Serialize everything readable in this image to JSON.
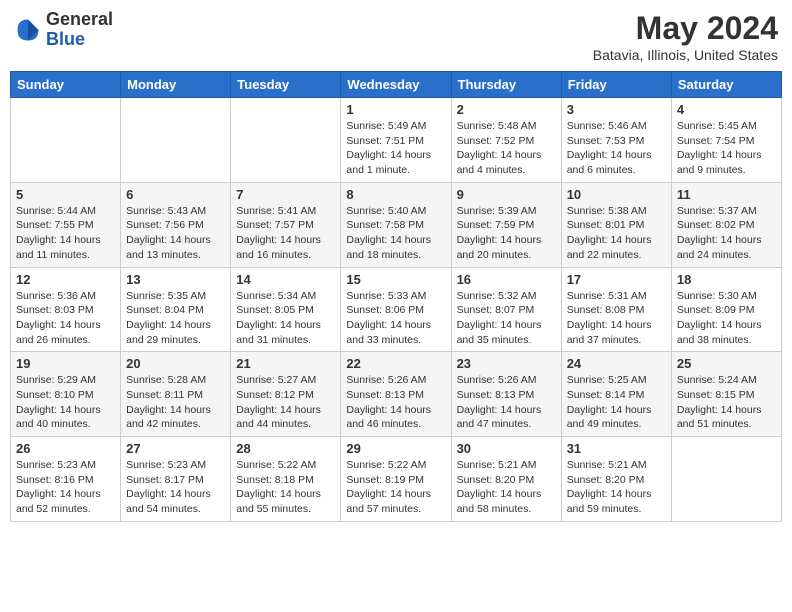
{
  "header": {
    "logo_general": "General",
    "logo_blue": "Blue",
    "month": "May 2024",
    "location": "Batavia, Illinois, United States"
  },
  "days_of_week": [
    "Sunday",
    "Monday",
    "Tuesday",
    "Wednesday",
    "Thursday",
    "Friday",
    "Saturday"
  ],
  "weeks": [
    [
      {
        "day": "",
        "sunrise": "",
        "sunset": "",
        "daylight": ""
      },
      {
        "day": "",
        "sunrise": "",
        "sunset": "",
        "daylight": ""
      },
      {
        "day": "",
        "sunrise": "",
        "sunset": "",
        "daylight": ""
      },
      {
        "day": "1",
        "sunrise": "Sunrise: 5:49 AM",
        "sunset": "Sunset: 7:51 PM",
        "daylight": "Daylight: 14 hours and 1 minute."
      },
      {
        "day": "2",
        "sunrise": "Sunrise: 5:48 AM",
        "sunset": "Sunset: 7:52 PM",
        "daylight": "Daylight: 14 hours and 4 minutes."
      },
      {
        "day": "3",
        "sunrise": "Sunrise: 5:46 AM",
        "sunset": "Sunset: 7:53 PM",
        "daylight": "Daylight: 14 hours and 6 minutes."
      },
      {
        "day": "4",
        "sunrise": "Sunrise: 5:45 AM",
        "sunset": "Sunset: 7:54 PM",
        "daylight": "Daylight: 14 hours and 9 minutes."
      }
    ],
    [
      {
        "day": "5",
        "sunrise": "Sunrise: 5:44 AM",
        "sunset": "Sunset: 7:55 PM",
        "daylight": "Daylight: 14 hours and 11 minutes."
      },
      {
        "day": "6",
        "sunrise": "Sunrise: 5:43 AM",
        "sunset": "Sunset: 7:56 PM",
        "daylight": "Daylight: 14 hours and 13 minutes."
      },
      {
        "day": "7",
        "sunrise": "Sunrise: 5:41 AM",
        "sunset": "Sunset: 7:57 PM",
        "daylight": "Daylight: 14 hours and 16 minutes."
      },
      {
        "day": "8",
        "sunrise": "Sunrise: 5:40 AM",
        "sunset": "Sunset: 7:58 PM",
        "daylight": "Daylight: 14 hours and 18 minutes."
      },
      {
        "day": "9",
        "sunrise": "Sunrise: 5:39 AM",
        "sunset": "Sunset: 7:59 PM",
        "daylight": "Daylight: 14 hours and 20 minutes."
      },
      {
        "day": "10",
        "sunrise": "Sunrise: 5:38 AM",
        "sunset": "Sunset: 8:01 PM",
        "daylight": "Daylight: 14 hours and 22 minutes."
      },
      {
        "day": "11",
        "sunrise": "Sunrise: 5:37 AM",
        "sunset": "Sunset: 8:02 PM",
        "daylight": "Daylight: 14 hours and 24 minutes."
      }
    ],
    [
      {
        "day": "12",
        "sunrise": "Sunrise: 5:36 AM",
        "sunset": "Sunset: 8:03 PM",
        "daylight": "Daylight: 14 hours and 26 minutes."
      },
      {
        "day": "13",
        "sunrise": "Sunrise: 5:35 AM",
        "sunset": "Sunset: 8:04 PM",
        "daylight": "Daylight: 14 hours and 29 minutes."
      },
      {
        "day": "14",
        "sunrise": "Sunrise: 5:34 AM",
        "sunset": "Sunset: 8:05 PM",
        "daylight": "Daylight: 14 hours and 31 minutes."
      },
      {
        "day": "15",
        "sunrise": "Sunrise: 5:33 AM",
        "sunset": "Sunset: 8:06 PM",
        "daylight": "Daylight: 14 hours and 33 minutes."
      },
      {
        "day": "16",
        "sunrise": "Sunrise: 5:32 AM",
        "sunset": "Sunset: 8:07 PM",
        "daylight": "Daylight: 14 hours and 35 minutes."
      },
      {
        "day": "17",
        "sunrise": "Sunrise: 5:31 AM",
        "sunset": "Sunset: 8:08 PM",
        "daylight": "Daylight: 14 hours and 37 minutes."
      },
      {
        "day": "18",
        "sunrise": "Sunrise: 5:30 AM",
        "sunset": "Sunset: 8:09 PM",
        "daylight": "Daylight: 14 hours and 38 minutes."
      }
    ],
    [
      {
        "day": "19",
        "sunrise": "Sunrise: 5:29 AM",
        "sunset": "Sunset: 8:10 PM",
        "daylight": "Daylight: 14 hours and 40 minutes."
      },
      {
        "day": "20",
        "sunrise": "Sunrise: 5:28 AM",
        "sunset": "Sunset: 8:11 PM",
        "daylight": "Daylight: 14 hours and 42 minutes."
      },
      {
        "day": "21",
        "sunrise": "Sunrise: 5:27 AM",
        "sunset": "Sunset: 8:12 PM",
        "daylight": "Daylight: 14 hours and 44 minutes."
      },
      {
        "day": "22",
        "sunrise": "Sunrise: 5:26 AM",
        "sunset": "Sunset: 8:13 PM",
        "daylight": "Daylight: 14 hours and 46 minutes."
      },
      {
        "day": "23",
        "sunrise": "Sunrise: 5:26 AM",
        "sunset": "Sunset: 8:13 PM",
        "daylight": "Daylight: 14 hours and 47 minutes."
      },
      {
        "day": "24",
        "sunrise": "Sunrise: 5:25 AM",
        "sunset": "Sunset: 8:14 PM",
        "daylight": "Daylight: 14 hours and 49 minutes."
      },
      {
        "day": "25",
        "sunrise": "Sunrise: 5:24 AM",
        "sunset": "Sunset: 8:15 PM",
        "daylight": "Daylight: 14 hours and 51 minutes."
      }
    ],
    [
      {
        "day": "26",
        "sunrise": "Sunrise: 5:23 AM",
        "sunset": "Sunset: 8:16 PM",
        "daylight": "Daylight: 14 hours and 52 minutes."
      },
      {
        "day": "27",
        "sunrise": "Sunrise: 5:23 AM",
        "sunset": "Sunset: 8:17 PM",
        "daylight": "Daylight: 14 hours and 54 minutes."
      },
      {
        "day": "28",
        "sunrise": "Sunrise: 5:22 AM",
        "sunset": "Sunset: 8:18 PM",
        "daylight": "Daylight: 14 hours and 55 minutes."
      },
      {
        "day": "29",
        "sunrise": "Sunrise: 5:22 AM",
        "sunset": "Sunset: 8:19 PM",
        "daylight": "Daylight: 14 hours and 57 minutes."
      },
      {
        "day": "30",
        "sunrise": "Sunrise: 5:21 AM",
        "sunset": "Sunset: 8:20 PM",
        "daylight": "Daylight: 14 hours and 58 minutes."
      },
      {
        "day": "31",
        "sunrise": "Sunrise: 5:21 AM",
        "sunset": "Sunset: 8:20 PM",
        "daylight": "Daylight: 14 hours and 59 minutes."
      },
      {
        "day": "",
        "sunrise": "",
        "sunset": "",
        "daylight": ""
      }
    ]
  ]
}
